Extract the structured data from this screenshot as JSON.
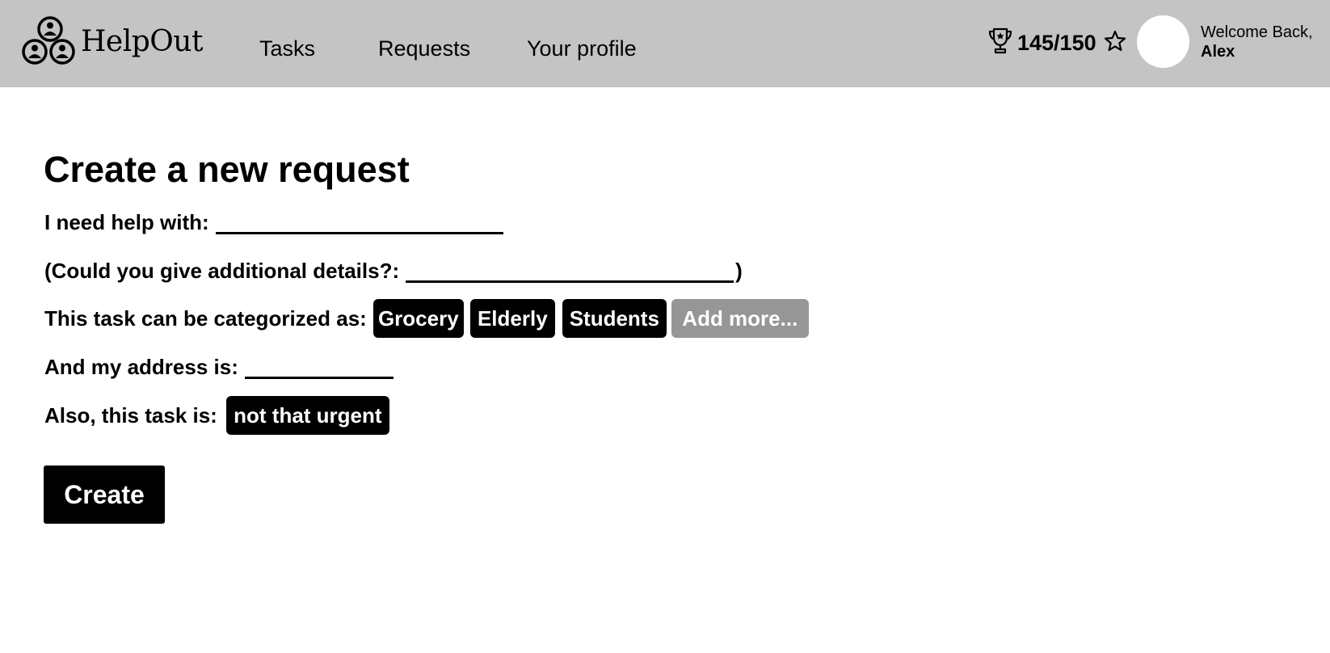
{
  "header": {
    "logo": {
      "text": "HelpOut",
      "icon": "three-people-icon"
    },
    "nav": [
      {
        "label": "Tasks"
      },
      {
        "label": "Requests"
      },
      {
        "label": "Your profile"
      }
    ],
    "points": {
      "value": "145/150",
      "icon": "trophy-icon",
      "star_icon": "star-outline-icon"
    },
    "user": {
      "welcome": "Welcome Back,",
      "name": "Alex"
    }
  },
  "form": {
    "title": "Create a new request",
    "help_label": "I need help with:",
    "details_label": "(Could you give additional details?:",
    "details_close": ")",
    "category_label": "This task can be categorized as:",
    "categories": [
      "Grocery",
      "Elderly",
      "Students"
    ],
    "add_more": "Add more...",
    "address_label": "And my address is:",
    "urgency_label": "Also, this task is:",
    "urgency_value": "not that urgent",
    "create_button": "Create"
  },
  "colors": {
    "header_bg": "#c4c4c4",
    "chip_bg": "#000000",
    "chip_disabled_bg": "#969696",
    "page_bg": "#ffffff"
  }
}
